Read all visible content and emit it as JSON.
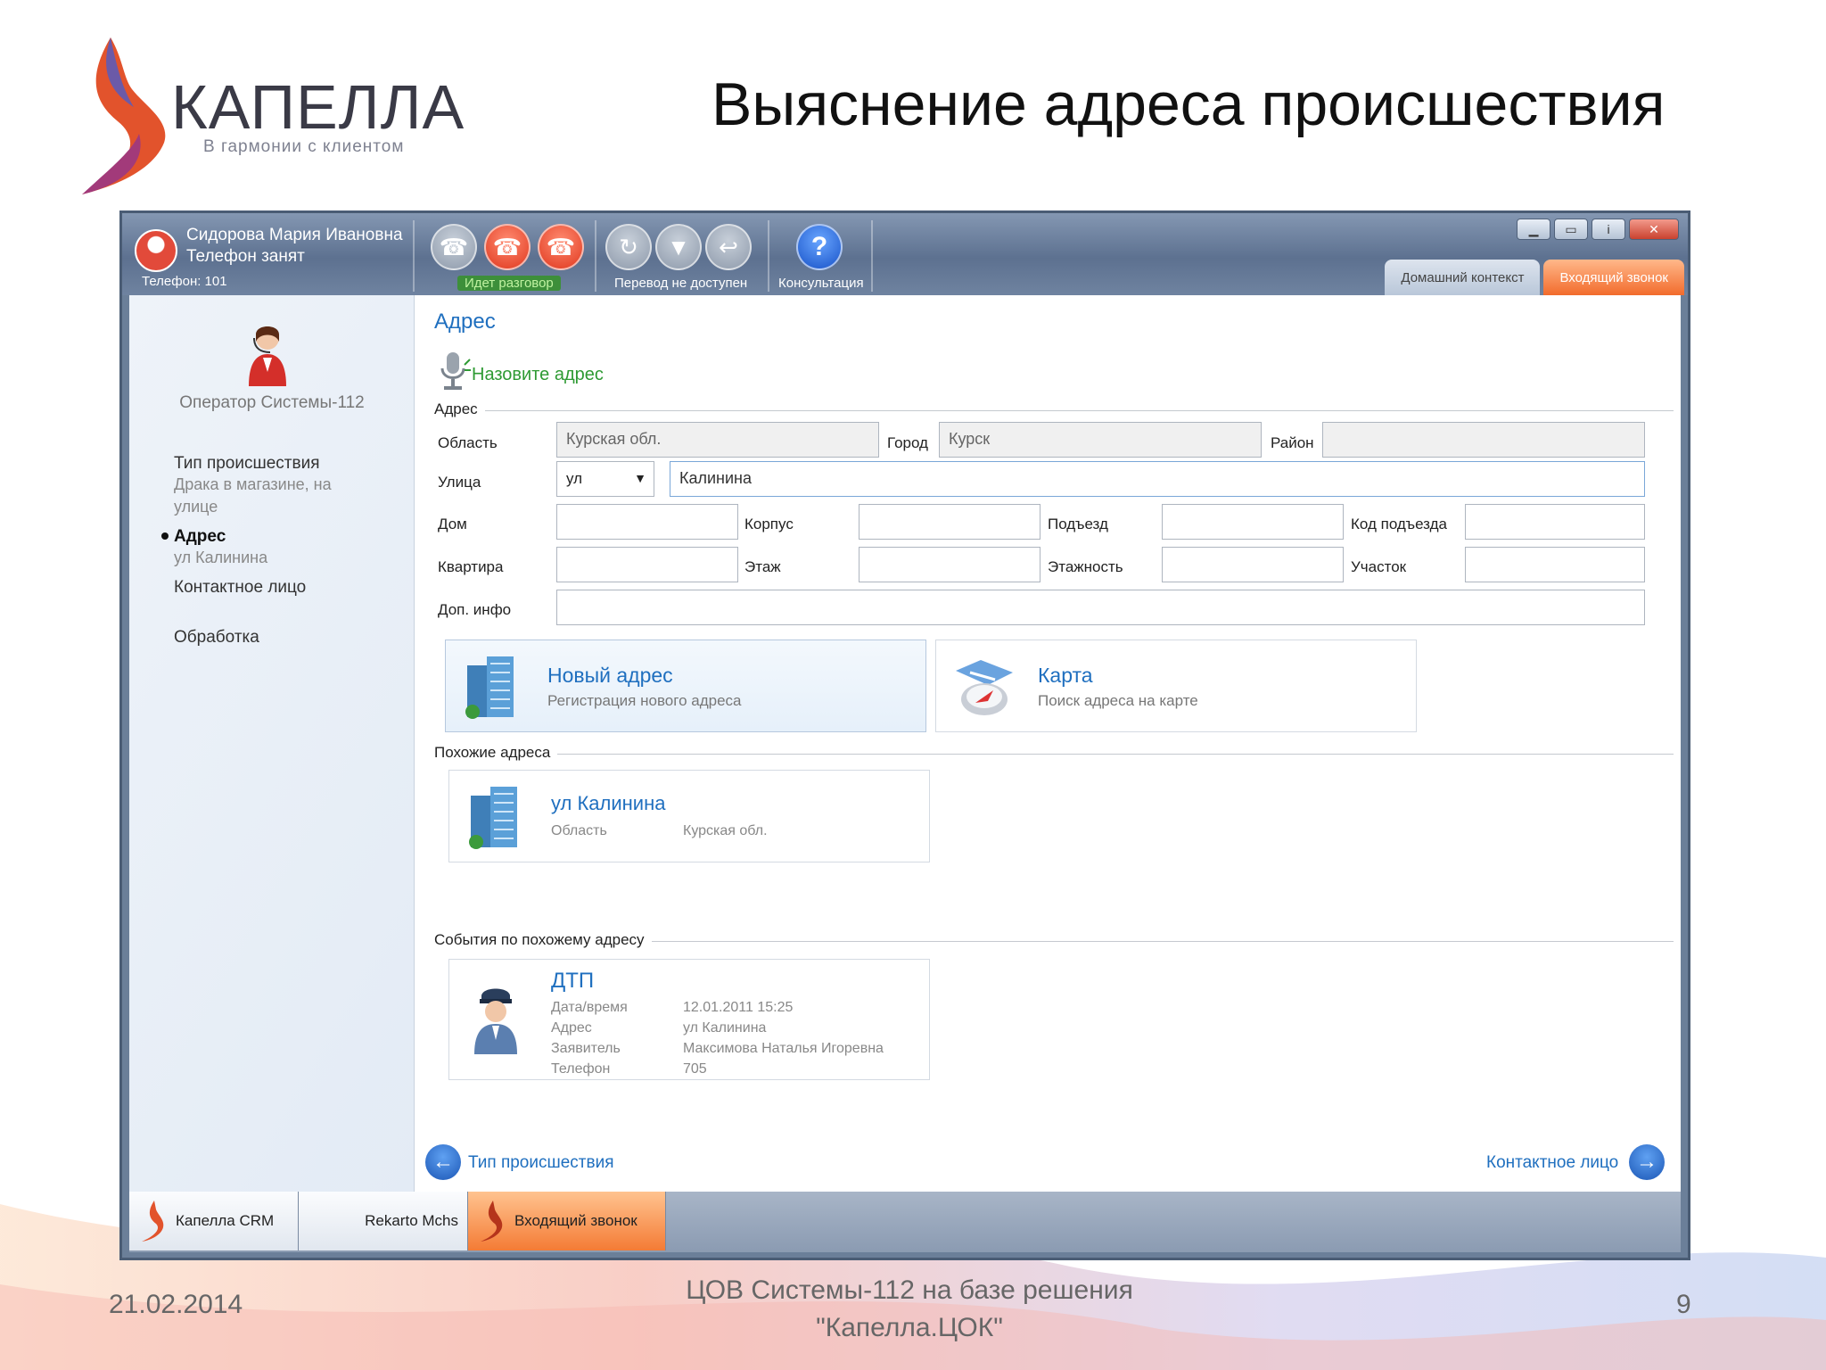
{
  "slide": {
    "title": "Выяснение адреса происшествия",
    "logo_word": "КАПЕЛЛА",
    "logo_tagline": "В гармонии с клиентом",
    "footer_date": "21.02.2014",
    "footer_caption_line1": "ЦОВ Системы-112 на базе решения",
    "footer_caption_line2": "\"Капелла.ЦОК\"",
    "page_number": "9"
  },
  "titlebar": {
    "user_name": "Сидорова Мария Ивановна",
    "user_status": "Телефон занят",
    "phone": "Телефон: 101",
    "group_call_label": "Идет разговор",
    "group_transfer_label": "Перевод не доступен",
    "consult_label": "Консультация",
    "tabs": [
      "Домашний контекст",
      "Входящий звонок"
    ],
    "window_buttons": [
      "minimize-icon",
      "restore-icon",
      "info-icon",
      "close-icon"
    ]
  },
  "sidebar": {
    "operator": "Оператор Системы-112",
    "steps": [
      {
        "title": "Тип происшествия",
        "sub": "Драка в магазине, на улице"
      },
      {
        "title": "Адрес",
        "sub": "ул Калинина"
      },
      {
        "title": "Контактное лицо",
        "sub": ""
      },
      {
        "title": "Обработка",
        "sub": ""
      }
    ]
  },
  "main": {
    "section_title": "Адрес",
    "voice_prompt": "Назовите адрес",
    "address_group": "Адрес",
    "fields": {
      "region_label": "Область",
      "region_value": "Курская обл.",
      "city_label": "Город",
      "city_value": "Курск",
      "district_label": "Район",
      "district_value": "",
      "street_label": "Улица",
      "street_type": "ул",
      "street_value": "Калинина",
      "house_label": "Дом",
      "building_label": "Корпус",
      "entrance_label": "Подъезд",
      "entrance_code_label": "Код подъезда",
      "apartment_label": "Квартира",
      "floor_label": "Этаж",
      "floors_label": "Этажность",
      "section_label": "Участок",
      "extra_label": "Доп. инфо"
    },
    "actions": [
      {
        "title": "Новый адрес",
        "sub": "Регистрация нового адреса"
      },
      {
        "title": "Карта",
        "sub": "Поиск адреса на карте"
      }
    ],
    "similar_group": "Похожие адреса",
    "similar": {
      "title": "ул Калинина",
      "k": "Область",
      "v": "Курская обл."
    },
    "events_group": "События по похожему адресу",
    "event": {
      "title": "ДТП",
      "rows": [
        {
          "k": "Дата/время",
          "v": "12.01.2011 15:25"
        },
        {
          "k": "Адрес",
          "v": "ул Калинина"
        },
        {
          "k": "Заявитель",
          "v": "Максимова Наталья Игоревна"
        },
        {
          "k": "Телефон",
          "v": "705"
        }
      ]
    },
    "nav_back": "Тип происшествия",
    "nav_next": "Контактное лицо"
  },
  "taskbar": [
    "Капелла CRM",
    "Rekarto Mchs",
    "Входящий звонок"
  ],
  "colors": {
    "accent": "#1f6fbf",
    "orange": "#f47b35",
    "red": "#e0381e",
    "green_text": "#2e9a33"
  }
}
